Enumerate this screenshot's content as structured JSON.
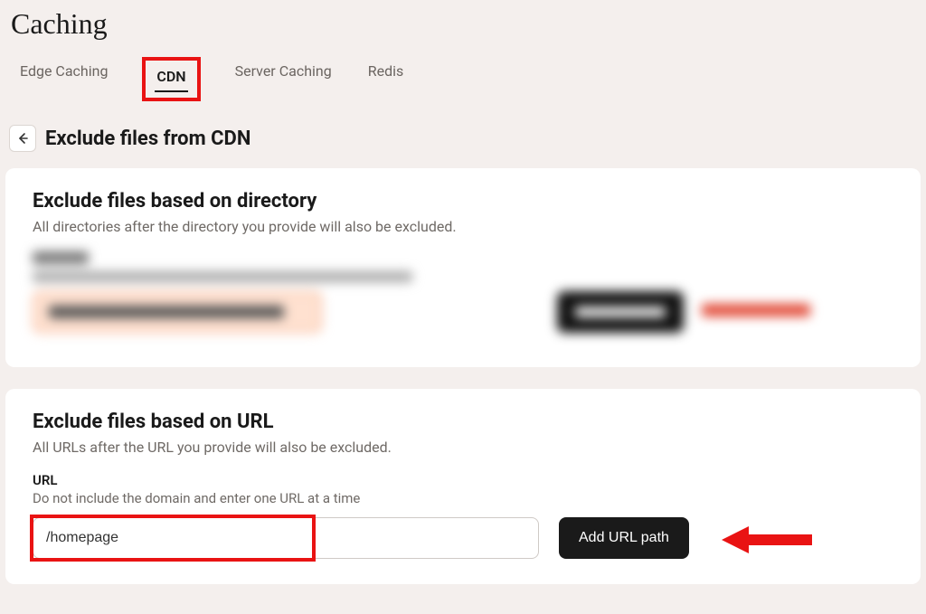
{
  "page_title": "Caching",
  "tabs": {
    "edge": "Edge Caching",
    "cdn": "CDN",
    "server": "Server Caching",
    "redis": "Redis"
  },
  "subheader": "Exclude files from CDN",
  "card_directory": {
    "title": "Exclude files based on directory",
    "desc": "All directories after the directory you provide will also be excluded."
  },
  "card_url": {
    "title": "Exclude files based on URL",
    "desc": "All URLs after the URL you provide will also be excluded.",
    "field_label": "URL",
    "field_help": "Do not include the domain and enter one URL at a time",
    "input_value": "/homepage",
    "button_label": "Add URL path"
  }
}
